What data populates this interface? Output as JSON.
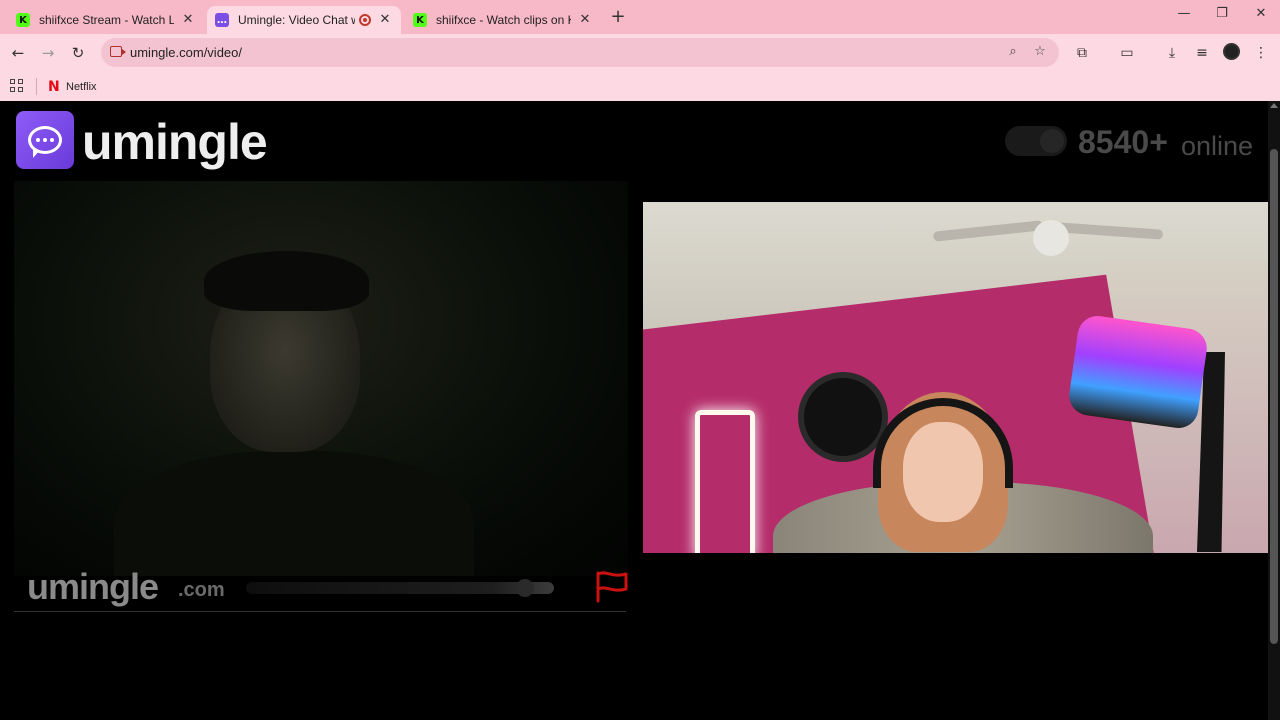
{
  "browser": {
    "tabs": [
      {
        "title": "shiifxce Stream - Watch Live on",
        "favicon": "kick-icon",
        "active": false
      },
      {
        "title": "Umingle: Video Chat with St",
        "favicon": "umingle-icon",
        "active": true,
        "recording": true
      },
      {
        "title": "shiifxce - Watch clips on Kick",
        "favicon": "kick-icon",
        "active": false
      }
    ],
    "tab_close_glyph": "✕",
    "new_tab_glyph": "+",
    "window_controls": {
      "minimize": "—",
      "maximize": "❐",
      "close": "✕"
    },
    "nav": {
      "back": "←",
      "forward": "→",
      "reload": "↻"
    },
    "address_bar": {
      "url": "umingle.com/video/"
    },
    "omnibox_icons": {
      "zoom": "⌕",
      "bookmark": "☆"
    },
    "toolbar_icons": {
      "extensions": "⧉",
      "cast": "▭",
      "downloads": "⤓",
      "media": "≡",
      "menu": "⋮"
    },
    "bookmarks": [
      {
        "label": "Netflix",
        "icon_glyph": "N"
      }
    ],
    "colors": {
      "tab_bar": "#f7b8c8",
      "toolbar": "#fdd9e3"
    }
  },
  "site": {
    "logo_text": "umingle",
    "online_count": "8540+",
    "online_label": "online",
    "watermark_brand": "umingle",
    "watermark_tld": ".com",
    "accent_color": "#7b4fe6",
    "report_flag_color": "#cc1111"
  }
}
